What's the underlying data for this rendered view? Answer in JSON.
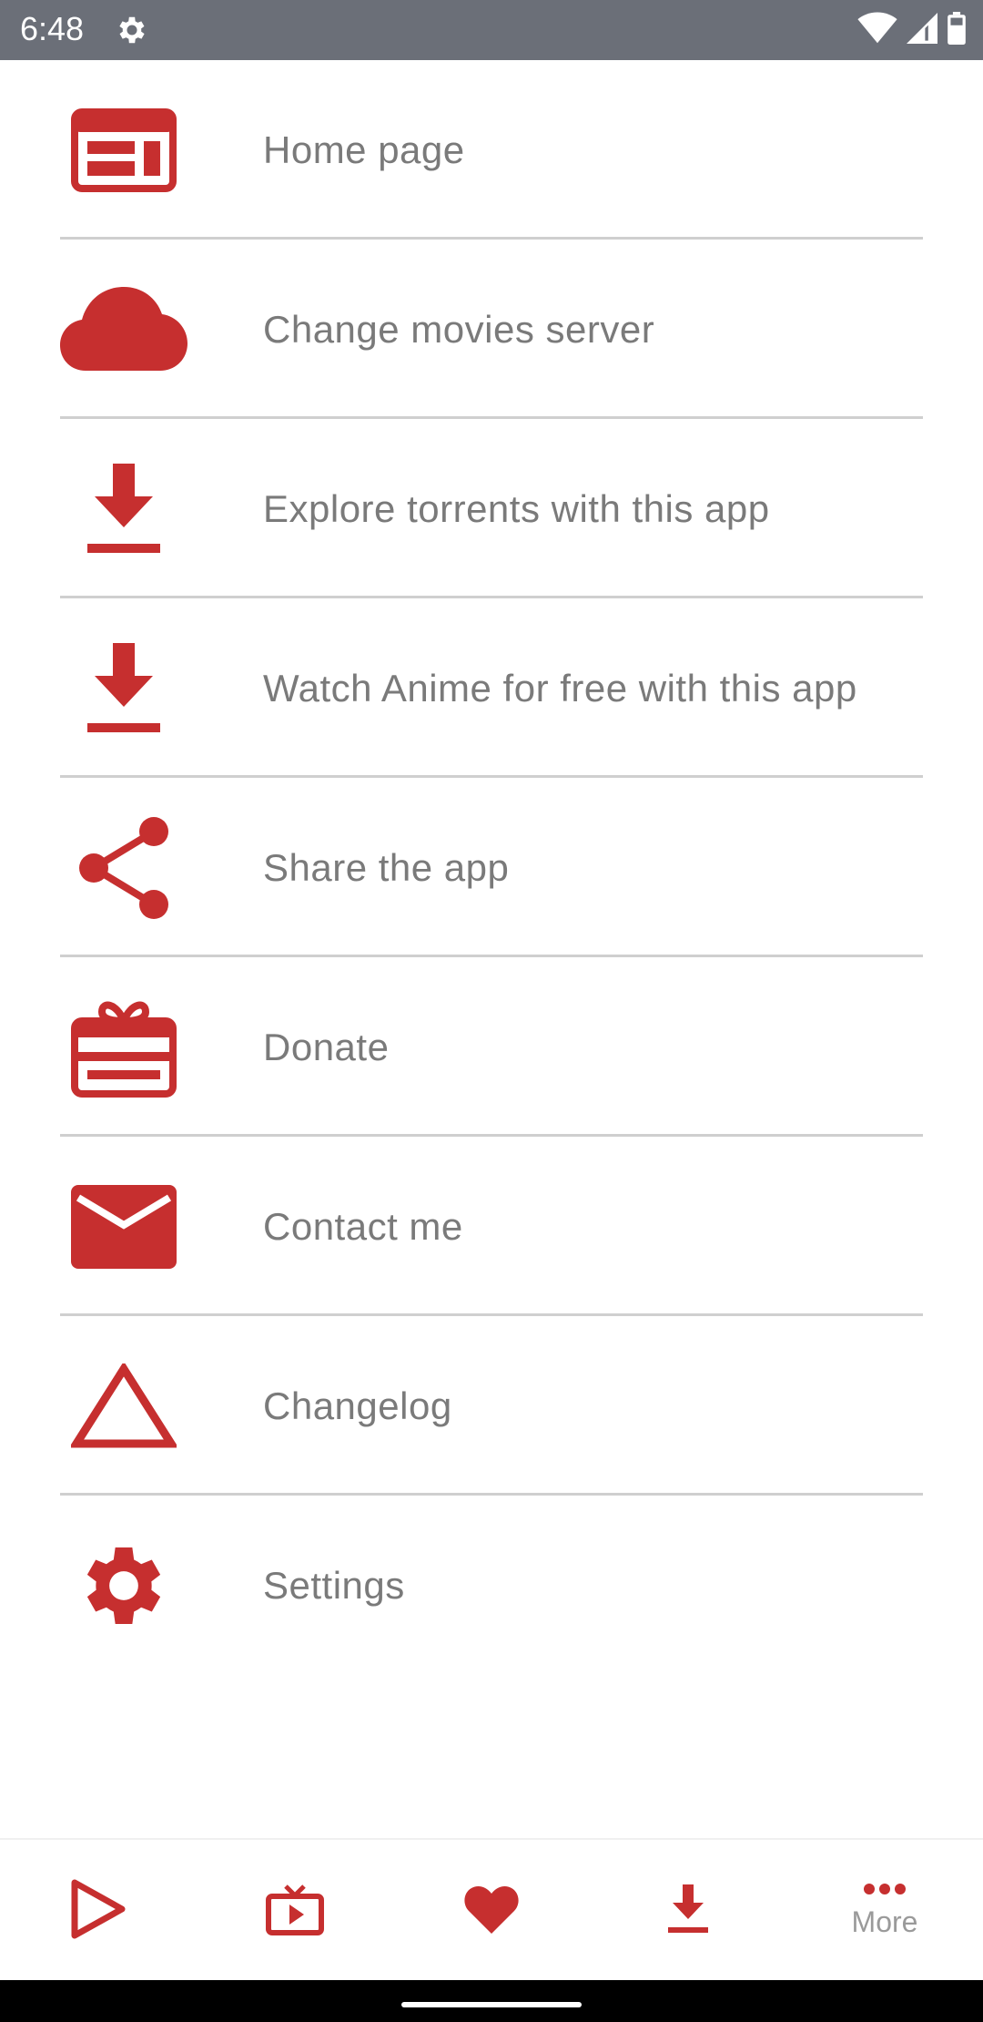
{
  "status_bar": {
    "time": "6:48"
  },
  "colors": {
    "accent": "#c62f2f",
    "text": "#7a7a7a",
    "status_bar": "#6b6f78"
  },
  "menu": {
    "items": [
      {
        "label": "Home page",
        "icon": "home-page-icon"
      },
      {
        "label": "Change movies server",
        "icon": "cloud-icon"
      },
      {
        "label": "Explore torrents with this app",
        "icon": "download-icon"
      },
      {
        "label": "Watch Anime for free with this app",
        "icon": "download-icon"
      },
      {
        "label": "Share the app",
        "icon": "share-icon"
      },
      {
        "label": "Donate",
        "icon": "gift-icon"
      },
      {
        "label": "Contact me",
        "icon": "mail-icon"
      },
      {
        "label": "Changelog",
        "icon": "triangle-icon"
      },
      {
        "label": "Settings",
        "icon": "gear-icon"
      }
    ]
  },
  "bottom_nav": {
    "items": [
      {
        "icon": "play-icon"
      },
      {
        "icon": "tv-icon"
      },
      {
        "icon": "heart-icon"
      },
      {
        "icon": "download-icon"
      },
      {
        "icon": "more-icon",
        "label": "More"
      }
    ]
  }
}
